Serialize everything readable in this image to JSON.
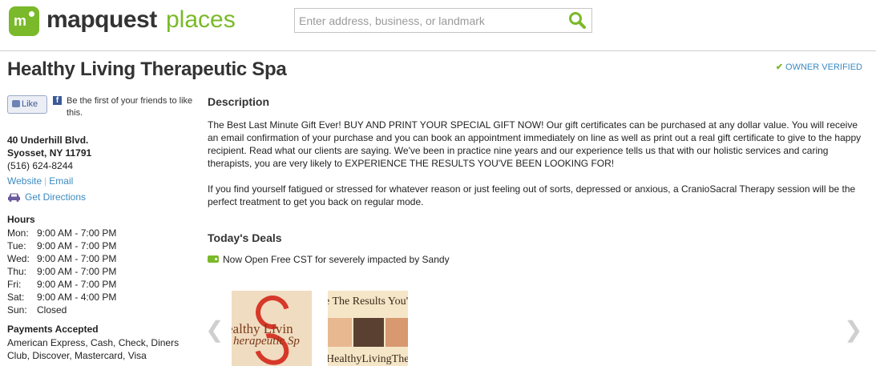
{
  "header": {
    "logo_mark": "m",
    "logo_text": "mapquest",
    "logo_places": "places",
    "search_placeholder": "Enter address, business, or landmark",
    "search_icon": "search-icon"
  },
  "business": {
    "name": "Healthy Living Therapeutic Spa",
    "verified": "OWNER VERIFIED",
    "address_line1": "40 Underhill Blvd.",
    "address_line2": "Syosset, NY 11791",
    "phone": "(516) 624-8244",
    "website_label": "Website",
    "email_label": "Email",
    "directions_label": "Get Directions"
  },
  "facebook": {
    "like_label": "Like",
    "friends_text": "Be the first of your friends to like this."
  },
  "hours": {
    "title": "Hours",
    "rows": [
      {
        "day": "Mon:",
        "time": "9:00 AM - 7:00 PM"
      },
      {
        "day": "Tue:",
        "time": "9:00 AM - 7:00 PM"
      },
      {
        "day": "Wed:",
        "time": "9:00 AM - 7:00 PM"
      },
      {
        "day": "Thu:",
        "time": "9:00 AM - 7:00 PM"
      },
      {
        "day": "Fri:",
        "time": "9:00 AM - 7:00 PM"
      },
      {
        "day": "Sat:",
        "time": "9:00 AM - 4:00 PM"
      },
      {
        "day": "Sun:",
        "time": "Closed"
      }
    ]
  },
  "payments": {
    "title": "Payments Accepted",
    "text": "American Express, Cash, Check, Diners Club, Discover, Mastercard, Visa"
  },
  "description": {
    "title": "Description",
    "paragraphs": [
      "The Best Last Minute Gift Ever! BUY AND PRINT YOUR SPECIAL GIFT NOW! Our gift certificates can be purchased at any dollar value. You will receive an email confirmation of your purchase and you can book an appointment immediately on line as well as print out a real gift certificate to give to the happy recipient. Read what our clients are saying. We've been in practice nine years and our experience tells us that with our holistic services and caring therapists, you are very likely to EXPERIENCE THE RESULTS YOU'VE BEEN LOOKING FOR!",
      "If you find yourself fatigued or stressed for whatever reason or just feeling out of sorts, depressed or anxious, a CranioSacral Therapy session will be the perfect treatment to get you back on regular mode."
    ]
  },
  "deals": {
    "title": "Today's Deals",
    "items": [
      "Now Open Free CST for severely impacted by Sandy"
    ]
  },
  "gallery": {
    "prev_glyph": "❮",
    "next_glyph": "❯",
    "image1_line1": "ealthy Livin",
    "image1_line2": "herapeutic Sp",
    "image2_top": "e The Results You'v",
    "image2_bottom": "HealthyLivingTher"
  },
  "colors": {
    "brand_green": "#7ab929",
    "link_blue": "#3b8bc2",
    "facebook_blue": "#3b5998"
  }
}
